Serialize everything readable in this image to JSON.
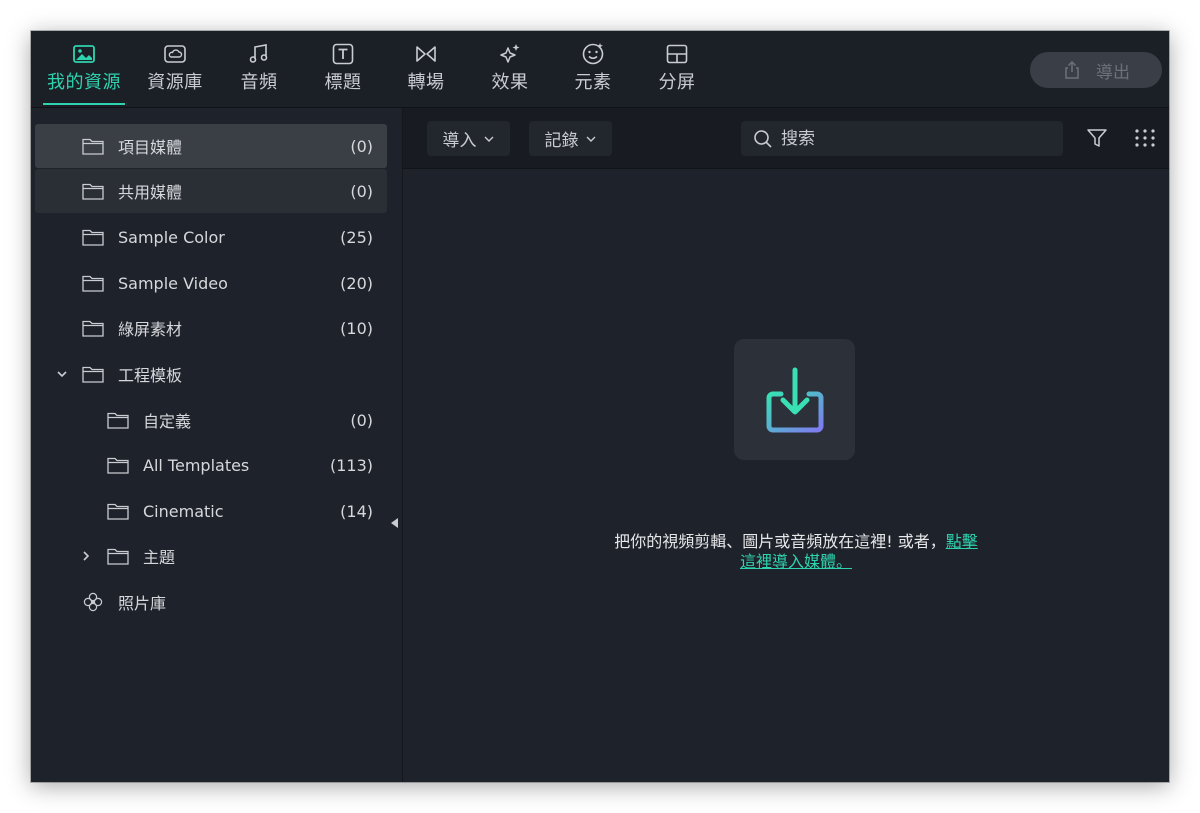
{
  "tabs": [
    {
      "label": "我的資源",
      "icon": "image-icon",
      "active": true
    },
    {
      "label": "資源庫",
      "icon": "cloud-folder-icon",
      "active": false
    },
    {
      "label": "音頻",
      "icon": "music-icon",
      "active": false
    },
    {
      "label": "標題",
      "icon": "text-icon",
      "active": false
    },
    {
      "label": "轉場",
      "icon": "transition-icon",
      "active": false
    },
    {
      "label": "效果",
      "icon": "sparkle-icon",
      "active": false
    },
    {
      "label": "元素",
      "icon": "sticker-icon",
      "active": false
    },
    {
      "label": "分屏",
      "icon": "split-screen-icon",
      "active": false
    }
  ],
  "export": {
    "label": "導出",
    "icon": "share-icon"
  },
  "sidebar": {
    "items": [
      {
        "label": "項目媒體",
        "count": "(0)"
      },
      {
        "label": "共用媒體",
        "count": "(0)"
      },
      {
        "label": "Sample Color",
        "count": "(25)"
      },
      {
        "label": "Sample Video",
        "count": "(20)"
      },
      {
        "label": "綠屏素材",
        "count": "(10)"
      },
      {
        "label": "工程模板",
        "count": ""
      },
      {
        "label": "自定義",
        "count": "(0)"
      },
      {
        "label": "All Templates",
        "count": "(113)"
      },
      {
        "label": "Cinematic",
        "count": "(14)"
      },
      {
        "label": "主題",
        "count": ""
      },
      {
        "label": "照片庫",
        "count": ""
      }
    ]
  },
  "toolbar": {
    "import_label": "導入",
    "record_label": "記錄",
    "search_placeholder": "搜索"
  },
  "drop": {
    "message": "把你的視頻剪輯、圖片或音頻放在這裡! 或者，",
    "link_part1": "點擊",
    "link_part2": "這裡導入媒體。"
  },
  "colors": {
    "accent": "#2ed4b0",
    "background": "#1e222a",
    "selected": "#3a3e45"
  }
}
